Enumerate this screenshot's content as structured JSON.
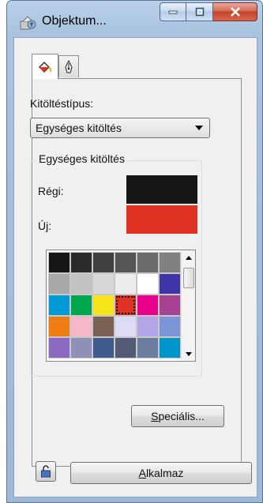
{
  "window": {
    "title": "Objektum...",
    "buttons": {
      "minimize": "minimize-icon",
      "maximize": "maximize-icon",
      "close": "close-icon"
    }
  },
  "tabs": [
    {
      "icon": "fill-bucket-icon",
      "active": true
    },
    {
      "icon": "pen-nib-icon",
      "active": false
    }
  ],
  "fill": {
    "type_label": "Kitöltéstípus:",
    "type_value": "Egységes kitöltés"
  },
  "group": {
    "title": "Egységes kitöltés",
    "old_label": "Régi:",
    "new_label": "Új:",
    "old_color": "#161616",
    "new_color": "#e03223"
  },
  "palette": {
    "selected_index": 15,
    "colors": [
      "#161616",
      "#2b2b2b",
      "#404040",
      "#555555",
      "#6b6b6b",
      "#808080",
      "#a8a8a8",
      "#c2c2c2",
      "#d8d8d8",
      "#ececec",
      "#ffffff",
      "#3f35a6",
      "#009bd6",
      "#00a64f",
      "#f6e51a",
      "#e03223",
      "#e6008a",
      "#a64291",
      "#f07c14",
      "#f6b8c6",
      "#7b6153",
      "#dcdcf6",
      "#b4a6e6",
      "#7b95d6",
      "#8c69c2",
      "#8f90b8",
      "#405a8d",
      "#525a75",
      "#6b7da1",
      "#0095c8"
    ]
  },
  "buttons": {
    "special_prefix": "",
    "special_hotkey": "S",
    "special_rest": "peciális...",
    "apply_hotkey": "A",
    "apply_rest": "lkalmaz",
    "lock": "lock-icon"
  }
}
